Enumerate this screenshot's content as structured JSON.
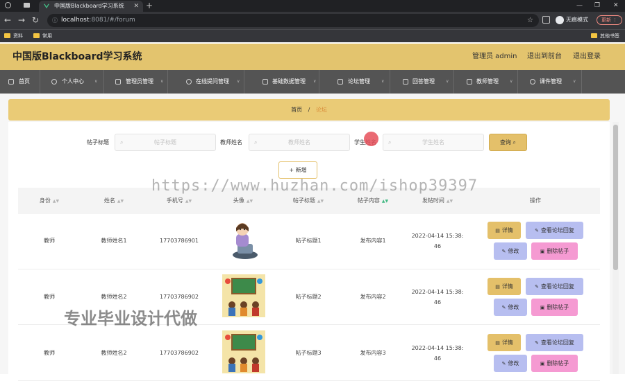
{
  "browser": {
    "tab_title": "中国版Blackboard学习系统",
    "url_host": "localhost",
    "url_path": ":8081/#/forum",
    "incognito_label": "无痕模式",
    "update_label": "更新",
    "bookmarks": [
      "资料",
      "常用"
    ],
    "other_bookmarks": "其他书签"
  },
  "header": {
    "title": "中国版Blackboard学习系统",
    "user": "管理员 admin",
    "back_front": "退出到前台",
    "logout": "退出登录"
  },
  "nav": [
    {
      "label": "首页",
      "icon": "home-icon"
    },
    {
      "label": "个人中心",
      "icon": "user-icon"
    },
    {
      "label": "管理员管理",
      "icon": "admin-icon"
    },
    {
      "label": "在线提问管理",
      "icon": "question-icon"
    },
    {
      "label": "基础数据管理",
      "icon": "data-icon"
    },
    {
      "label": "论坛管理",
      "icon": "forum-icon"
    },
    {
      "label": "回答管理",
      "icon": "answer-icon"
    },
    {
      "label": "教师管理",
      "icon": "teacher-icon"
    },
    {
      "label": "课件管理",
      "icon": "courseware-icon"
    }
  ],
  "breadcrumb": {
    "home": "首页",
    "sep": "/",
    "current": "论坛"
  },
  "search": {
    "title_label": "帖子标题",
    "title_placeholder": "帖子标题",
    "teacher_label": "教师姓名",
    "teacher_placeholder": "教师姓名",
    "student_label": "学生姓名",
    "student_placeholder": "学生姓名",
    "query_button": "查询",
    "add_button": "新增"
  },
  "table": {
    "columns": [
      "身份",
      "姓名",
      "手机号",
      "头像",
      "帖子标题",
      "帖子内容",
      "发帖时间",
      "操作"
    ],
    "rows": [
      {
        "role": "教师",
        "name": "教师姓名1",
        "phone": "17703786901",
        "title": "帖子标题1",
        "content": "发布内容1",
        "time_line1": "2022-04-14 15:38:",
        "time_line2": "46"
      },
      {
        "role": "教师",
        "name": "教师姓名2",
        "phone": "17703786902",
        "title": "帖子标题2",
        "content": "发布内容2",
        "time_line1": "2022-04-14 15:38:",
        "time_line2": "46"
      },
      {
        "role": "教师",
        "name": "教师姓名2",
        "phone": "17703786902",
        "title": "帖子标题3",
        "content": "发布内容3",
        "time_line1": "2022-04-14 15:38:",
        "time_line2": "46"
      }
    ],
    "actions": {
      "detail": "详情",
      "view_reply": "查看论坛回复",
      "edit": "修改",
      "delete": "删除帖子"
    }
  },
  "watermarks": {
    "url": "https://www.huzhan.com/ishop39397",
    "text": "专业毕业设计代做"
  },
  "colors": {
    "accent": "#e3c46e",
    "nav_bg": "#545454",
    "delete": "#f59ad2",
    "secondary": "#b7bef0"
  }
}
